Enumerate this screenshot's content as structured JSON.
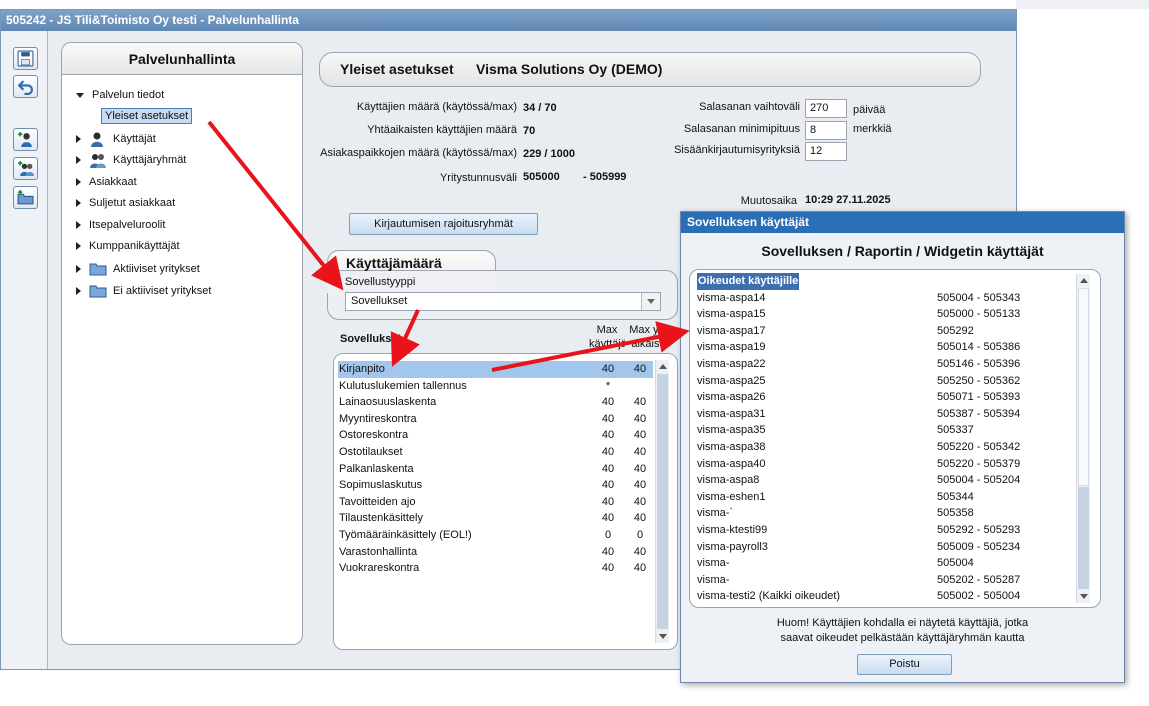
{
  "window": {
    "title": "505242 - JS Tili&Toimisto Oy testi - Palvelunhallinta"
  },
  "toolbar": {
    "buttons": [
      {
        "name": "save-button",
        "icon": "disk-icon"
      },
      {
        "name": "back-button",
        "icon": "undo-arrow-icon"
      },
      {
        "name": "add-user-button",
        "icon": "add-user-icon"
      },
      {
        "name": "add-group-button",
        "icon": "add-group-icon"
      },
      {
        "name": "add-company-button",
        "icon": "add-folder-icon"
      }
    ]
  },
  "tree": {
    "title": "Palvelunhallinta",
    "items": [
      {
        "label": "Palvelun tiedot"
      },
      {
        "label": "Yleiset asetukset"
      },
      {
        "label": "Käyttäjät"
      },
      {
        "label": "Käyttäjäryhmät"
      },
      {
        "label": "Asiakkaat"
      },
      {
        "label": "Suljetut asiakkaat"
      },
      {
        "label": "Itsepalveluroolit"
      },
      {
        "label": "Kumppanikäyttäjät"
      },
      {
        "label": "Aktiiviset yritykset"
      },
      {
        "label": "Ei aktiiviset yritykset"
      }
    ]
  },
  "header": {
    "section": "Yleiset asetukset",
    "company": "Visma Solutions Oy (DEMO)"
  },
  "settings": {
    "users_label": "Käyttäjien määrä (käytössä/max)",
    "users_value": "34 / 70",
    "concurrent_label": "Yhtäaikaisten käyttäjien määrä",
    "concurrent_value": "70",
    "clients_label": "Asiakaspaikkojen määrä (käytössä/max)",
    "clients_value": "229 / 1000",
    "range_label": "Yritystunnusväli",
    "range_start": "505000",
    "range_end": "- 505999",
    "pw_change_label": "Salasanan vaihtoväli",
    "pw_change_value": "270",
    "pw_change_unit": "päivää",
    "pw_min_label": "Salasanan minimipituus",
    "pw_min_value": "8",
    "pw_min_unit": "merkkiä",
    "login_attempts_label": "Sisäänkirjautumisyrityksiä",
    "login_attempts_value": "12",
    "modified_label": "Muutosaika",
    "modified_value": "10:29 27.11.2025",
    "restriction_button": "Kirjautumisen rajoitusryhmät"
  },
  "user_count": {
    "title": "Käyttäjämäärä",
    "app_type_label": "Sovellustyyppi",
    "app_type_value": "Sovellukset"
  },
  "apps": {
    "header_name": "Sovellukset",
    "header_max_users": "Max käyttäjät",
    "header_max_concurrent": "Max yht. aikaiset",
    "rows": [
      {
        "name": "Kirjanpito",
        "a": "40",
        "b": "40"
      },
      {
        "name": "Kulutuslukemien tallennus",
        "a": "*",
        "b": ""
      },
      {
        "name": "Lainaosuuslaskenta",
        "a": "40",
        "b": "40"
      },
      {
        "name": "Myyntireskontra",
        "a": "40",
        "b": "40"
      },
      {
        "name": "Ostoreskontra",
        "a": "40",
        "b": "40"
      },
      {
        "name": "Ostotilaukset",
        "a": "40",
        "b": "40"
      },
      {
        "name": "Palkanlaskenta",
        "a": "40",
        "b": "40"
      },
      {
        "name": "Sopimuslaskutus",
        "a": "40",
        "b": "40"
      },
      {
        "name": "Tavoitteiden ajo",
        "a": "40",
        "b": "40"
      },
      {
        "name": "Tilaustenkäsittely",
        "a": "40",
        "b": "40"
      },
      {
        "name": "Työmääräinkäsittely (EOL!)",
        "a": "0",
        "b": "0"
      },
      {
        "name": "Varastonhallinta",
        "a": "40",
        "b": "40"
      },
      {
        "name": "Vuokrareskontra",
        "a": "40",
        "b": "40"
      }
    ]
  },
  "dialog": {
    "title": "Sovelluksen käyttäjät",
    "heading": "Sovelluksen / Raportin / Widgetin käyttäjät",
    "list_header": "Oikeudet käyttäjille",
    "users": [
      {
        "user": "visma-aspa14",
        "range": "505004 - 505343"
      },
      {
        "user": "visma-aspa15",
        "range": "505000 - 505133"
      },
      {
        "user": "visma-aspa17",
        "range": "505292"
      },
      {
        "user": "visma-aspa19",
        "range": "505014 - 505386"
      },
      {
        "user": "visma-aspa22",
        "range": "505146 - 505396"
      },
      {
        "user": "visma-aspa25",
        "range": "505250 - 505362"
      },
      {
        "user": "visma-aspa26",
        "range": "505071 - 505393"
      },
      {
        "user": "visma-aspa31",
        "range": "505387 - 505394"
      },
      {
        "user": "visma-aspa35",
        "range": "505337"
      },
      {
        "user": "visma-aspa38",
        "range": "505220 - 505342"
      },
      {
        "user": "visma-aspa40",
        "range": "505220 - 505379"
      },
      {
        "user": "visma-aspa8",
        "range": "505004 - 505204"
      },
      {
        "user": "visma-eshen1",
        "range": "505344"
      },
      {
        "user": "visma-`",
        "range": "505358"
      },
      {
        "user": "visma-ktesti99",
        "range": "505292 - 505293"
      },
      {
        "user": "visma-payroll3",
        "range": "505009 - 505234"
      },
      {
        "user": "visma-",
        "range": "505004"
      },
      {
        "user": "visma-",
        "range": "505202 - 505287"
      },
      {
        "user": "visma-testi2 (Kaikki oikeudet)",
        "range": "505002 - 505004"
      }
    ],
    "note_line1": "Huom! Käyttäjien kohdalla ei näytetä käyttäjiä, jotka",
    "note_line2": "saavat oikeudet pelkästään käyttäjäryhmän kautta",
    "remove_button": "Poistu"
  },
  "colors": {
    "accent": "#2a6fb5",
    "selection": "#a3c7ec",
    "annotation_arrow": "#e8141a"
  }
}
